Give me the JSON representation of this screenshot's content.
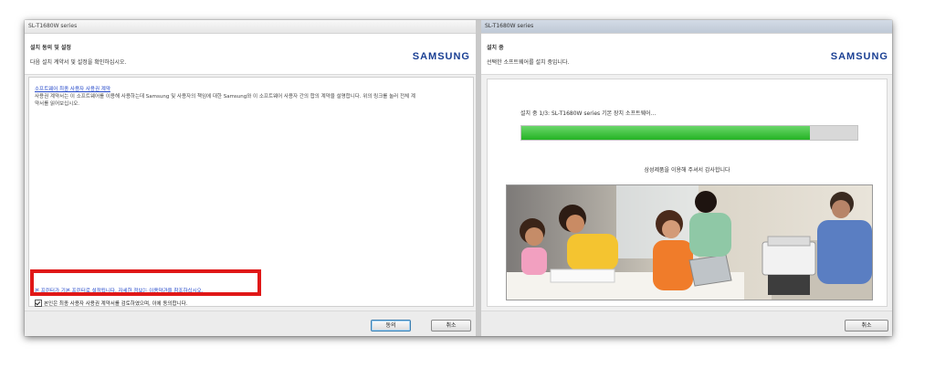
{
  "left_window": {
    "titlebar": "SL-T1680W series",
    "header_title": "설치 동의 및 설정",
    "header_subtitle": "다음 설치 계약서 및 설정을 확인하십시오.",
    "brand_logo": "SAMSUNG",
    "eula_link": "소프트웨어 최종 사용자 사용권 계약",
    "eula_text": "사용권 계약서는 이 소프트웨어를 이용해 사용하는데 Samsung 및 사용자의 책임에 대한 Samsung와 이 소프트웨어 사용자 간의 합의 계약을 설명합니다. 위의 링크를 눌러 전체 계약서를 읽어보십시오.",
    "bottom_link": "본 프린터가 기본 프린터로 설정됩니다. 자세한 정보는 이용약관을 참조하십시오.",
    "agree_checkbox_label": "본인은 최종 사용자 사용권 계약서를 검토하였으며, 이에 동의합니다.",
    "agree_checked": true,
    "agree_button": "동의",
    "cancel_button": "취소"
  },
  "right_window": {
    "titlebar": "SL-T1680W series",
    "header_title": "설치 중",
    "header_subtitle": "선택한 소프트웨어를 설치 중입니다.",
    "brand_logo": "SAMSUNG",
    "progress_label": "설치 중 1/3: SL-T1680W series 기본 장치 소프트웨어...",
    "progress_fraction": 0.86,
    "thanks_text": "삼성제품을 이용해 주셔서 감사합니다",
    "cancel_button": "취소"
  },
  "colors": {
    "highlight_box": "#e01818",
    "progress_green": "#24b324",
    "samsung_blue": "#1a3f93",
    "link_blue": "#2347c9"
  }
}
